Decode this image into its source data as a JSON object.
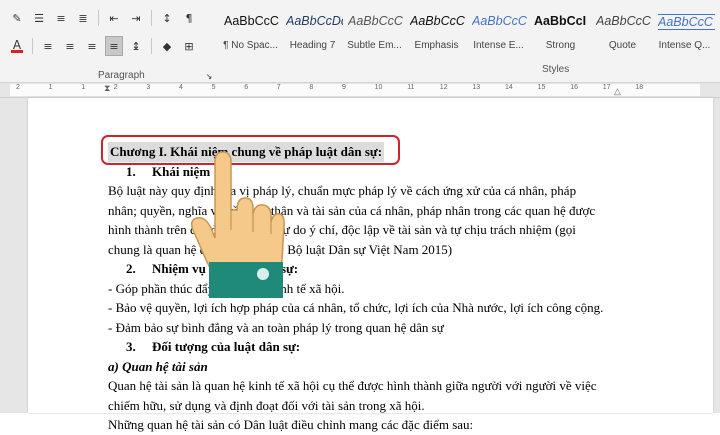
{
  "ribbon": {
    "paragraph_label": "Paragraph",
    "styles_label": "Styles",
    "styles": [
      {
        "preview": "AaBbCcC",
        "name": "¶ No Spac...",
        "italic": false,
        "bold": false
      },
      {
        "preview": "AaBbCcDd",
        "name": "Heading 7",
        "italic": true,
        "bold": false
      },
      {
        "preview": "AaBbCcC",
        "name": "Subtle Em...",
        "italic": true,
        "bold": false
      },
      {
        "preview": "AaBbCcC",
        "name": "Emphasis",
        "italic": true,
        "bold": false
      },
      {
        "preview": "AaBbCcC",
        "name": "Intense E...",
        "italic": true,
        "bold": false
      },
      {
        "preview": "AaBbCcI",
        "name": "Strong",
        "italic": false,
        "bold": true
      },
      {
        "preview": "AaBbCcC",
        "name": "Quote",
        "italic": true,
        "bold": false
      },
      {
        "preview": "AaBbCcC",
        "name": "Intense Q...",
        "italic": true,
        "bold": false
      }
    ]
  },
  "ruler": {
    "ticks": [
      "2",
      "1",
      "1",
      "2",
      "3",
      "4",
      "5",
      "6",
      "7",
      "8",
      "9",
      "10",
      "11",
      "12",
      "13",
      "14",
      "15",
      "16",
      "17",
      "18"
    ]
  },
  "document": {
    "chapter_title": "Chương I. Khái niệm chung về pháp luật dân sự:",
    "section1_number": "1.",
    "section1_title": "Khái niệm",
    "para1_line1": "Bộ luật này quy định địa vị pháp lý, chuẩn mực pháp lý về cách ứng xử của cá nhân, pháp",
    "para1_line2": "nhân; quyền, nghĩa vụ về nhân thân và tài sản của cá nhân, pháp nhân trong các quan hệ được",
    "para1_line3": "hình thành trên cơ sở bình đẳng, tự do ý chí, độc lập về tài sản và tự chịu trách nhiệm (gọi",
    "para1_line4": "chung là quan hệ dân sự). (Điều 1 Bộ luật Dân sự Việt Nam 2015)",
    "section2_number": "2.",
    "section2_title": "Nhiệm vụ của luật dân sự:",
    "task1": "- Góp phần thúc đẩy phát triển kinh tế xã hội.",
    "task2": "- Bảo vệ quyền, lợi ích hợp pháp của cá nhân, tổ chức, lợi ích của Nhà nước, lợi ích công cộng.",
    "task3": "- Đảm bảo sự bình đẳng và an toàn pháp lý trong quan hệ dân sự",
    "section3_number": "3.",
    "section3_title": "Đối tượng của luật dân sự:",
    "subsection_a": "a) Quan hệ tài sản",
    "para2_line1": "Quan hệ tài sản là quan hệ kinh tế xã hội cụ thể được hình thành giữa người với người về việc",
    "para2_line2": "chiếm hữu, sử dụng và định đoạt đối với tài sản trong xã hội.",
    "para2_line3": "Những quan hệ tài sản có Dân luật điều chỉnh mang các đặc điểm sau:"
  },
  "colors": {
    "highlight_border": "#d2232a",
    "hand_skin": "#f5c98a",
    "cuff": "#1f8a7a",
    "font_color_bar": "#e02020"
  }
}
